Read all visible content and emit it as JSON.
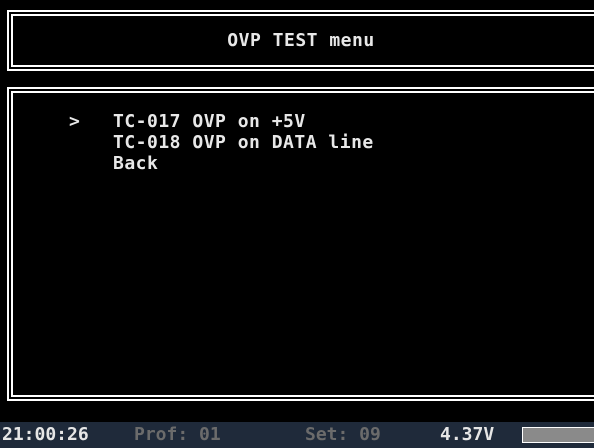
{
  "header": {
    "title": "OVP TEST menu"
  },
  "menu": {
    "cursor_glyph": ">",
    "selected_index": 0,
    "items": [
      {
        "label": "TC-017 OVP on +5V"
      },
      {
        "label": "TC-018 OVP on DATA line"
      },
      {
        "label": "Back"
      }
    ]
  },
  "status": {
    "time": "21:00:26",
    "profile": "Prof: 01",
    "set": "Set: 09",
    "voltage": "4.37V"
  },
  "colors": {
    "background": "#000000",
    "text": "#e8e8e8",
    "frame": "#ffffff",
    "status_bar_bg": "#1f2a3a",
    "status_dim_text": "#6b6b6b",
    "meter": "#8a8a8a"
  }
}
